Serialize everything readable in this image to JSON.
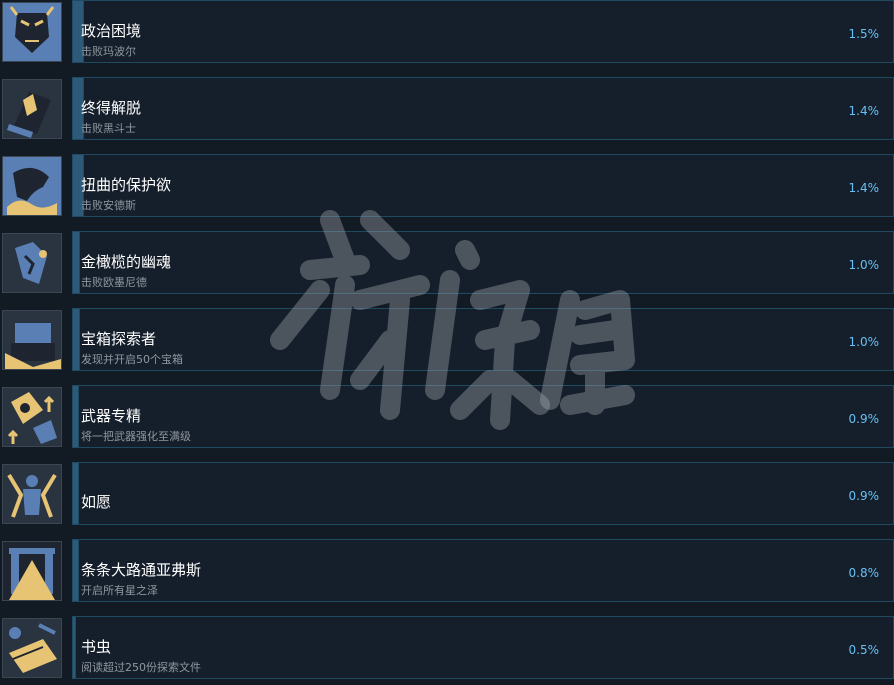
{
  "achievements": [
    {
      "title": "政治困境",
      "desc": "击败玛波尔",
      "percent": "1.5%",
      "fill": 0.015,
      "icon": "mask-icon"
    },
    {
      "title": "终得解脱",
      "desc": "击败黑斗士",
      "percent": "1.4%",
      "fill": 0.014,
      "icon": "armor-icon"
    },
    {
      "title": "扭曲的保护欲",
      "desc": "击败安德斯",
      "percent": "1.4%",
      "fill": 0.014,
      "icon": "profile-icon"
    },
    {
      "title": "金橄榄的幽魂",
      "desc": "击败欧墨尼德",
      "percent": "1.0%",
      "fill": 0.01,
      "icon": "ghost-icon"
    },
    {
      "title": "宝箱探索者",
      "desc": "发现并开启50个宝箱",
      "percent": "1.0%",
      "fill": 0.01,
      "icon": "chest-icon"
    },
    {
      "title": "武器专精",
      "desc": "将一把武器强化至满级",
      "percent": "0.9%",
      "fill": 0.009,
      "icon": "weapon-icon"
    },
    {
      "title": "如愿",
      "desc": "",
      "percent": "0.9%",
      "fill": 0.009,
      "icon": "figure-icon"
    },
    {
      "title": "条条大路通亚弗斯",
      "desc": "开启所有星之泽",
      "percent": "0.8%",
      "fill": 0.008,
      "icon": "gate-icon"
    },
    {
      "title": "书虫",
      "desc": "阅读超过250份探索文件",
      "percent": "0.5%",
      "fill": 0.005,
      "icon": "book-icon"
    }
  ],
  "watermark": "游侠网",
  "colors": {
    "background": "#121a24",
    "bar": "#151f2b",
    "bar_border": "#1f4a62",
    "progress": "#2d5a78",
    "title": "#ffffff",
    "desc": "#8f98a0",
    "percent": "#66c0f4",
    "icon_blue": "#5a7fb5",
    "icon_gold": "#e6c474"
  }
}
